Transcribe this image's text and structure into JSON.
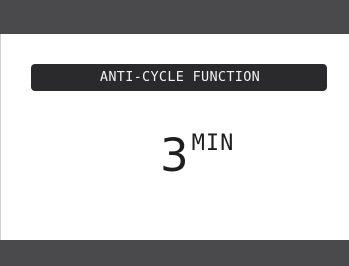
{
  "screen": {
    "title": "ANTI-CYCLE FUNCTION",
    "value": "3",
    "unit": "MIN"
  },
  "colors": {
    "bar": "#4a4a4c",
    "title_background": "#2a2a2c",
    "title_text": "#f2f2f2",
    "value_text": "#1e1e1e",
    "background": "#ffffff"
  }
}
